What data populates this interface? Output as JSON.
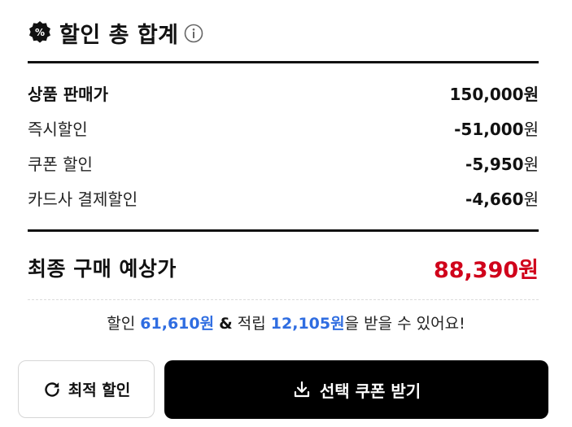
{
  "header": {
    "badge_symbol": "%",
    "title": "할인 총 합계",
    "icons": [
      "discount-badge-icon",
      "info-icon"
    ]
  },
  "breakdown": [
    {
      "label": "상품 판매가",
      "amount": "150,000",
      "unit": "원"
    },
    {
      "label": "즉시할인",
      "amount": "-51,000",
      "unit": "원"
    },
    {
      "label": "쿠폰 할인",
      "amount": "-5,950",
      "unit": "원"
    },
    {
      "label": "카드사 결제할인",
      "amount": "-4,660",
      "unit": "원"
    }
  ],
  "final": {
    "label": "최종 구매 예상가",
    "amount": "88,390원"
  },
  "summary": {
    "prefix": "할인",
    "discount": "61,610원",
    "amp": "&",
    "points_label": "적립",
    "points": "12,105원",
    "suffix": "을 받을 수 있어요!"
  },
  "buttons": {
    "optimal_label": "최적 할인",
    "coupon_label": "선택 쿠폰 받기"
  },
  "colors": {
    "accent_red": "#d0021b",
    "highlight_blue": "#2f6de1",
    "primary_black": "#000000"
  }
}
